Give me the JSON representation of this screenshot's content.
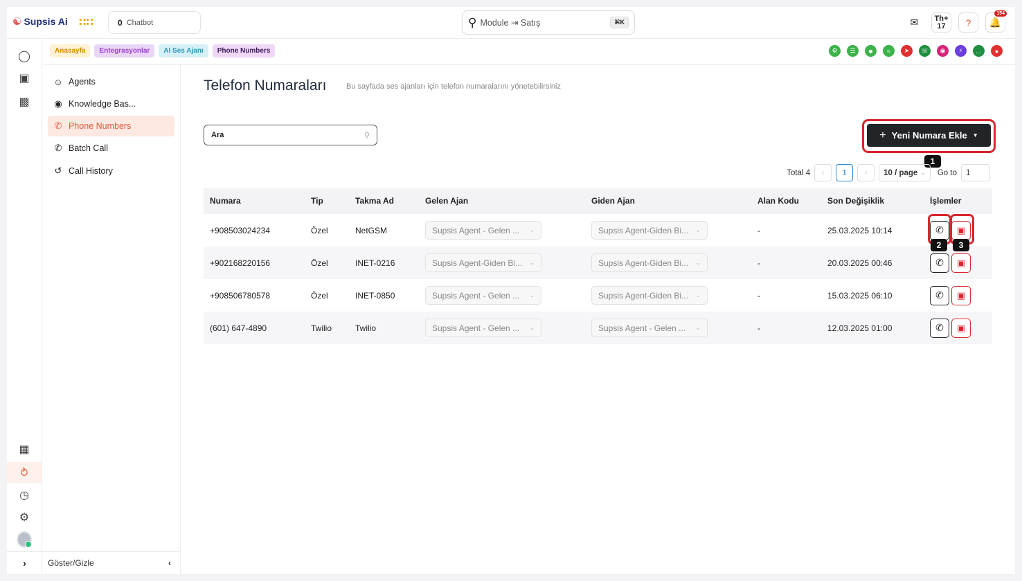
{
  "topbar": {
    "app_name": "Supsis Ai",
    "chatbot_count": "0",
    "chatbot_label": "Chatbot",
    "search_text": "Module ⇥ Satış",
    "search_shortcut": "⌘K",
    "th_label": "Th",
    "th_count": "17",
    "notification_count": "154"
  },
  "breadcrumbs": [
    "Anasayfa",
    "Entegrasyonlar",
    "AI Ses Ajanı",
    "Phone Numbers"
  ],
  "integrations": [
    {
      "name": "bot-icon",
      "color": "#3bb34a"
    },
    {
      "name": "list-icon",
      "color": "#3bb34a"
    },
    {
      "name": "voice-agent-icon",
      "color": "#3bb34a"
    },
    {
      "name": "wifi-icon",
      "color": "#3bb34a"
    },
    {
      "name": "telegram-icon",
      "color": "#e03030"
    },
    {
      "name": "whatsapp-icon",
      "color": "#1e8f3f"
    },
    {
      "name": "instagram-icon",
      "color": "#d6247a"
    },
    {
      "name": "messenger-icon",
      "color": "#6c3ce0"
    },
    {
      "name": "sms-icon",
      "color": "#1e8f3f"
    },
    {
      "name": "other-channel-icon",
      "color": "#e03030"
    }
  ],
  "sidebar": {
    "items": [
      {
        "label": "Agents",
        "icon": "agent-icon"
      },
      {
        "label": "Knowledge Bas...",
        "icon": "knowledge-icon"
      },
      {
        "label": "Phone Numbers",
        "icon": "phone-icon"
      },
      {
        "label": "Batch Call",
        "icon": "phone-icon"
      },
      {
        "label": "Call History",
        "icon": "history-icon"
      }
    ],
    "footer_label": "Göster/Gizle"
  },
  "page": {
    "title": "Telefon Numaraları",
    "subtitle": "Bu sayfada ses ajanları için telefon numaralarını yönetebilirsiniz",
    "search_placeholder": "Ara",
    "add_button": "Yeni Numara Ekle",
    "markers": [
      "1",
      "2",
      "3"
    ]
  },
  "pagination": {
    "total_label": "Total 4",
    "current_page": "1",
    "page_size": "10 / page",
    "goto_label": "Go to",
    "goto_value": "1"
  },
  "table": {
    "headers": [
      "Numara",
      "Tip",
      "Takma Ad",
      "Gelen Ajan",
      "Giden Ajan",
      "Alan Kodu",
      "Son Değişiklik",
      "İşlemler"
    ],
    "rows": [
      {
        "numara": "+908503024234",
        "tip": "Özel",
        "takma_ad": "NetGSM",
        "gelen": "Supsis Agent - Gelen ...",
        "giden": "Supsis Agent-Giden Bi...",
        "alan_kodu": "-",
        "son": "25.03.2025 10:14"
      },
      {
        "numara": "+902168220156",
        "tip": "Özel",
        "takma_ad": "INET-0216",
        "gelen": "Supsis Agent-Giden Bi...",
        "giden": "Supsis Agent-Giden Bi...",
        "alan_kodu": "-",
        "son": "20.03.2025 00:46"
      },
      {
        "numara": "+908506780578",
        "tip": "Özel",
        "takma_ad": "INET-0850",
        "gelen": "Supsis Agent - Gelen ...",
        "giden": "Supsis Agent-Giden Bi...",
        "alan_kodu": "-",
        "son": "15.03.2025 06:10"
      },
      {
        "numara": "(601) 647-4890",
        "tip": "Twilio",
        "takma_ad": "Twilio",
        "gelen": "Supsis Agent - Gelen ...",
        "giden": "Supsis Agent - Gelen ...",
        "alan_kodu": "-",
        "son": "12.03.2025 01:00"
      }
    ]
  },
  "colors": {
    "accent": "#e05a3c",
    "highlight": "#d9262e",
    "primary_button": "#222528"
  }
}
